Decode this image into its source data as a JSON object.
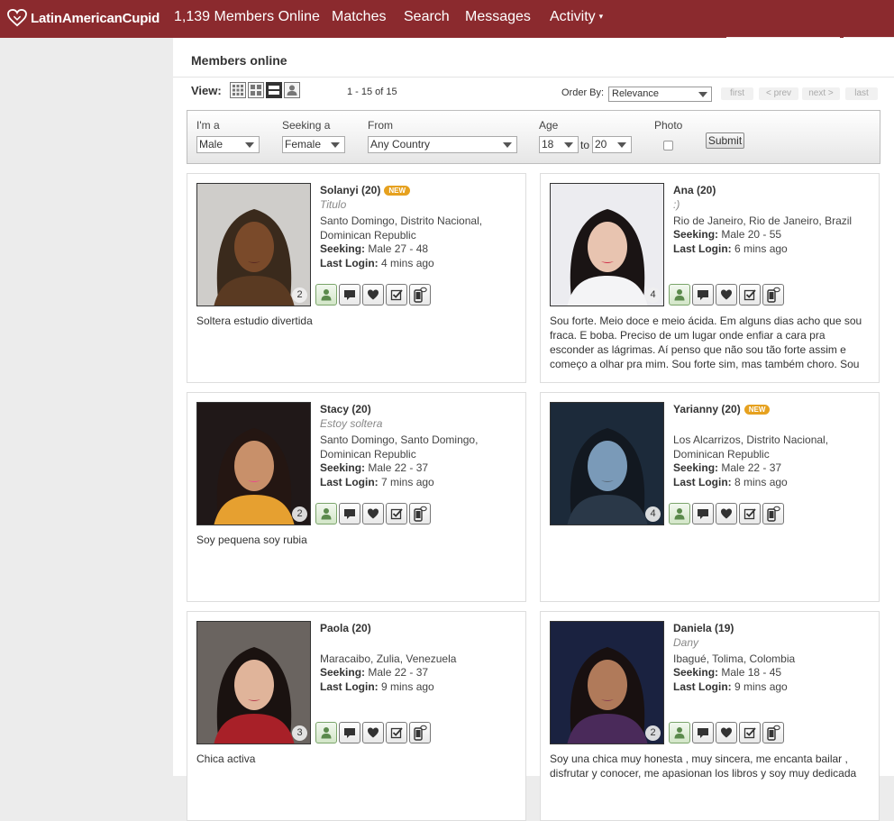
{
  "nav": {
    "logo_text": "LatinAmericanCupid",
    "members_online": "1,139 Members Online",
    "matches": "Matches",
    "search": "Search",
    "messages": "Messages",
    "activity": "Activity",
    "activity_caret": "▾"
  },
  "page": {
    "title": "Members online",
    "view_label": "View:",
    "count_text": "1 - 15 of 15",
    "order_by_label": "Order By:",
    "order_by_value": "Relevance",
    "pager": {
      "first": "first",
      "prev": "< prev",
      "next": "next >",
      "last": "last"
    }
  },
  "filters": {
    "im_a_label": "I'm a",
    "im_a_value": "Male",
    "seeking_label": "Seeking a",
    "seeking_value": "Female",
    "from_label": "From",
    "from_value": "Any Country",
    "age_label": "Age",
    "age_from": "18",
    "age_to_label": "to",
    "age_to": "20",
    "photo_label": "Photo",
    "submit": "Submit"
  },
  "labels": {
    "seeking": "Seeking:",
    "last_login": "Last Login:",
    "new_badge": "NEW"
  },
  "members": [
    {
      "name": "Solanyi (20)",
      "is_new": true,
      "headline": "Titulo",
      "location": "Santo Domingo, Distrito Nacional, Dominican Republic",
      "seeking": "Male 27 - 48",
      "last_login": "4 mins ago",
      "photo_count": "2",
      "description": "Soltera estudio divertida"
    },
    {
      "name": "Ana (20)",
      "is_new": false,
      "headline": ":)",
      "location": "Rio de Janeiro, Rio de Janeiro, Brazil",
      "seeking": "Male 20 - 55",
      "last_login": "6 mins ago",
      "photo_count": "4",
      "description": "Sou forte. Meio doce e meio ácida. Em alguns dias acho que sou fraca. E boba. Preciso de um lugar onde enfiar a cara pra esconder as lágrimas. Aí penso que não sou tão forte assim e começo a olhar pra mim. Sou forte sim, mas também choro. Sou"
    },
    {
      "name": "Stacy (20)",
      "is_new": false,
      "headline": "Estoy soltera",
      "location": "Santo Domingo, Santo Domingo, Dominican Republic",
      "seeking": "Male 22 - 37",
      "last_login": "7 mins ago",
      "photo_count": "2",
      "description": "Soy pequena soy rubia"
    },
    {
      "name": "Yarianny (20)",
      "is_new": true,
      "headline": "",
      "location": "Los Alcarrizos, Distrito Nacional, Dominican Republic",
      "seeking": "Male 22 - 37",
      "last_login": "8 mins ago",
      "photo_count": "4",
      "description": ""
    },
    {
      "name": "Paola (20)",
      "is_new": false,
      "headline": "",
      "location": "Maracaibo, Zulia, Venezuela",
      "seeking": "Male 22 - 37",
      "last_login": "9 mins ago",
      "photo_count": "3",
      "description": "Chica activa"
    },
    {
      "name": "Daniela (19)",
      "is_new": false,
      "headline": "Dany",
      "location": "Ibagué, Tolima, Colombia",
      "seeking": "Male 18 - 45",
      "last_login": "9 mins ago",
      "photo_count": "2",
      "description": "Soy una chica muy honesta , muy sincera, me encanta bailar , disfrutar y conocer, me apasionan los libros y soy muy dedicada"
    }
  ],
  "colors": {
    "header": "#8b2a2e",
    "new_badge": "#e6a11f",
    "action_green": "#d3e6c8"
  }
}
